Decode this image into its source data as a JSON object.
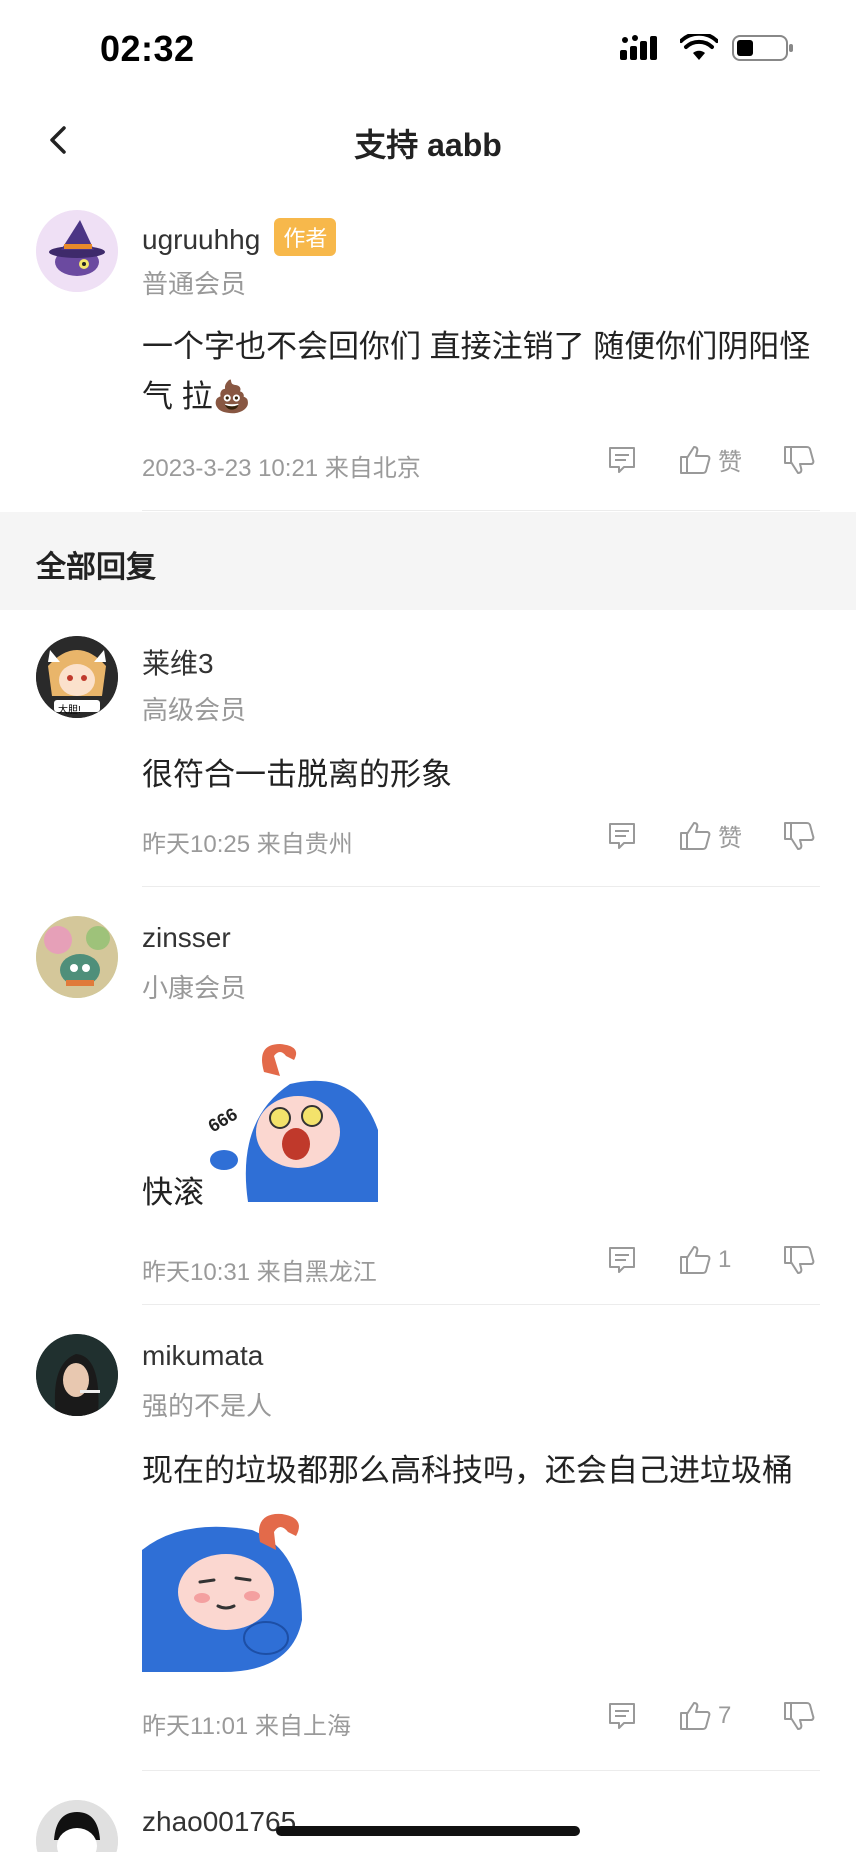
{
  "status_bar": {
    "time": "02:32",
    "icons": [
      "signal-icon",
      "wifi-icon",
      "battery-icon"
    ]
  },
  "nav": {
    "title": "支持 aabb",
    "back_icon": "chevron-left-icon"
  },
  "post": {
    "username": "ugruuhhg",
    "badge": "作者",
    "member": "普通会员",
    "content": "一个字也不会回你们 直接注销了 随便你们阴阳怪气 拉💩",
    "meta": "2023-3-23 10:21 来自北京",
    "like_label": "赞"
  },
  "section": {
    "title": "全部回复"
  },
  "replies": [
    {
      "username": "莱维3",
      "member": "高级会员",
      "content": "很符合一击脱离的形象",
      "meta": "昨天10:25 来自贵州",
      "like_label": "赞",
      "avatar_text": "大胆!"
    },
    {
      "username": "zinsser",
      "member": "小康会员",
      "content": "快滚",
      "meta": "昨天10:31 来自黑龙江",
      "like_label": "1",
      "sticker_text": "666"
    },
    {
      "username": "mikumata",
      "member": "强的不是人",
      "content": "现在的垃圾都那么高科技吗，还会自己进垃圾桶",
      "meta": "昨天11:01 来自上海",
      "like_label": "7"
    },
    {
      "username": "zhao001765"
    }
  ],
  "colors": {
    "badge": "#f7b84b",
    "meta_gray": "#9a9a9a",
    "section_bg": "#f5f5f5",
    "sticker_blue": "#2f6fd6"
  }
}
